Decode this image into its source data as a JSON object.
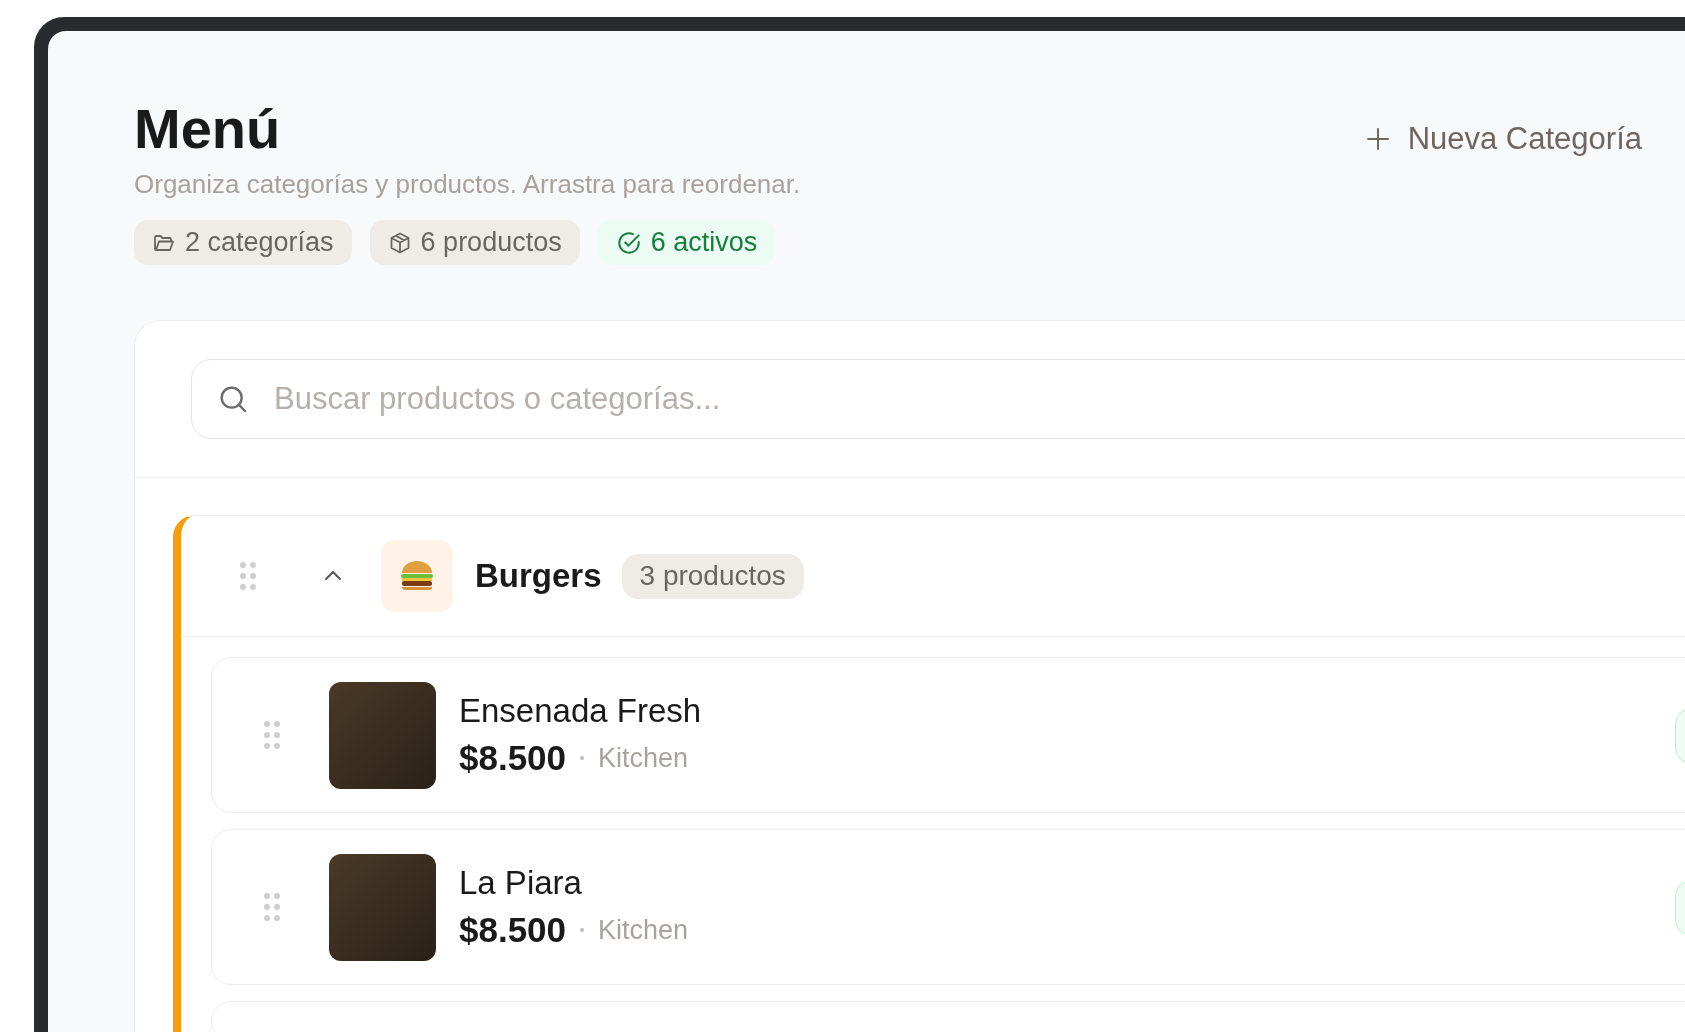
{
  "header": {
    "title": "Menú",
    "subtitle": "Organiza categorías y productos. Arrastra para reordenar.",
    "new_category_button": "Nueva Categoría"
  },
  "stats": [
    {
      "kind": "categories",
      "label": "2 categorías"
    },
    {
      "kind": "products",
      "label": "6 productos"
    },
    {
      "kind": "active",
      "label": "6 activos"
    }
  ],
  "search": {
    "placeholder": "Buscar productos o categorías..."
  },
  "categories": [
    {
      "name": "Burgers",
      "count": "3 productos",
      "expanded": true,
      "color": "#f59e0b",
      "products": [
        {
          "name": "Ensenada Fresh",
          "price": "$8.500",
          "station": "Kitchen"
        },
        {
          "name": "La Piara",
          "price": "$8.500",
          "station": "Kitchen"
        }
      ]
    }
  ]
}
